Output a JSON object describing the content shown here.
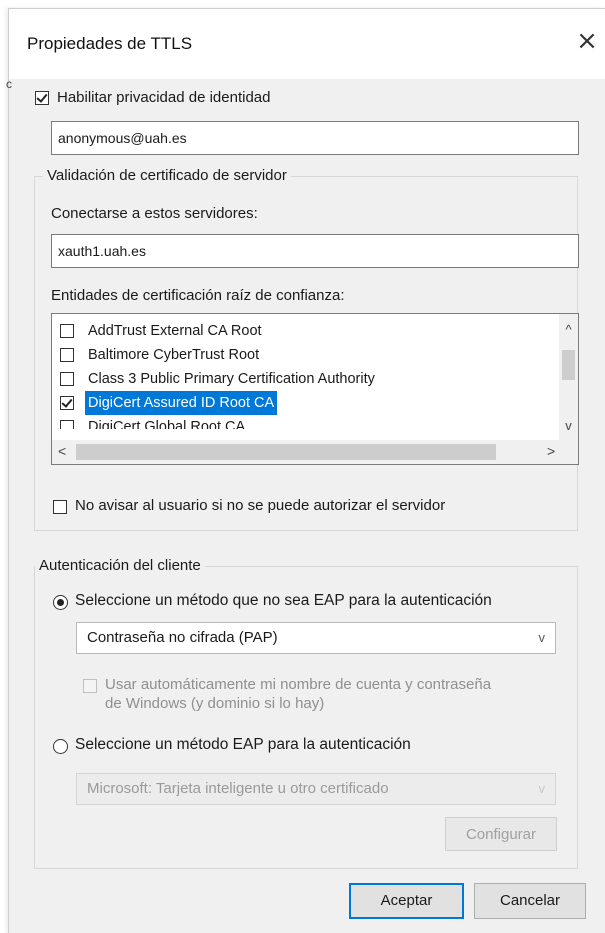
{
  "dialog": {
    "title": "Propiedades de TTLS",
    "close_glyph": "×",
    "edge_glyph": "c"
  },
  "identity": {
    "enable_label": "Habilitar privacidad de identidad",
    "enabled": true,
    "value": "anonymous@uah.es"
  },
  "server_validation": {
    "legend": "Validación de certificado de servidor",
    "servers_label": "Conectarse a estos servidores:",
    "servers_value": "xauth1.uah.es",
    "ca_label": "Entidades de certificación raíz de confianza:",
    "ca_list": [
      {
        "label": "AddTrust External CA Root",
        "checked": false,
        "selected": false
      },
      {
        "label": "Baltimore CyberTrust Root",
        "checked": false,
        "selected": false
      },
      {
        "label": "Class 3 Public Primary Certification Authority",
        "checked": false,
        "selected": false
      },
      {
        "label": "DigiCert Assured ID Root CA",
        "checked": true,
        "selected": true
      },
      {
        "label": "DigiCert Global Root CA",
        "checked": false,
        "selected": false
      }
    ],
    "scroll_up_glyph": "^",
    "scroll_down_glyph": "v",
    "scroll_left_glyph": "<",
    "scroll_right_glyph": ">",
    "no_prompt_label": "No avisar al usuario si no se puede autorizar el servidor",
    "no_prompt_checked": false
  },
  "client_auth": {
    "legend": "Autenticación del cliente",
    "non_eap_label": "Seleccione un método que no sea EAP para la autenticación",
    "non_eap_selected": true,
    "non_eap_method": "Contraseña no cifrada (PAP)",
    "auto_creds_line1": "Usar automáticamente mi nombre de cuenta y contraseña",
    "auto_creds_line2": "de Windows (y dominio si lo hay)",
    "eap_label": "Seleccione un método EAP para la autenticación",
    "eap_selected": false,
    "eap_method": "Microsoft: Tarjeta inteligente u otro certificado",
    "configure_label": "Configurar",
    "combo_arrow_glyph": "v"
  },
  "footer": {
    "ok_label": "Aceptar",
    "cancel_label": "Cancelar"
  }
}
